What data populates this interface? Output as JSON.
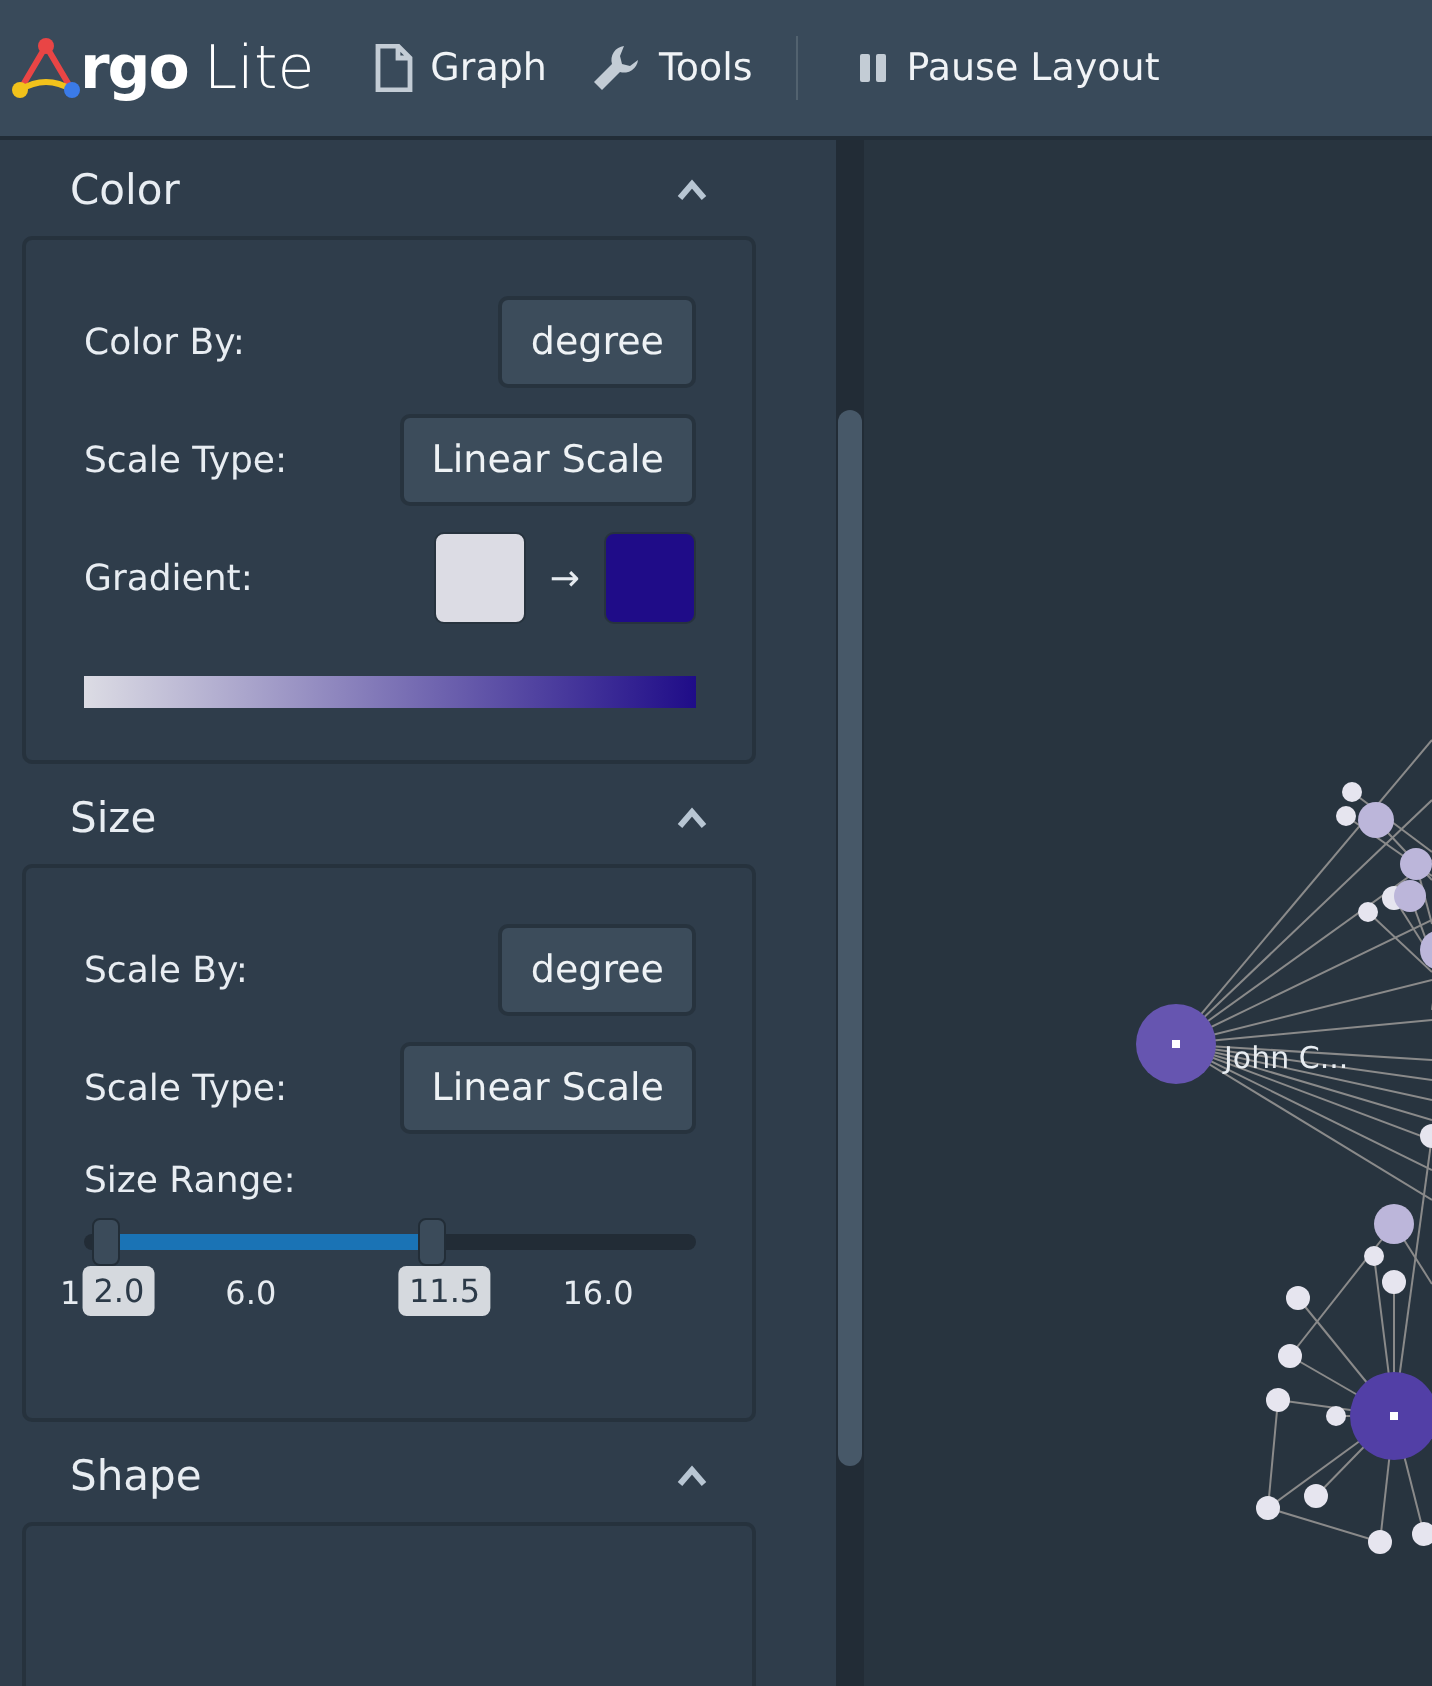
{
  "app": {
    "logo_word": "rgo",
    "logo_suffix": "Lite"
  },
  "toolbar": [
    {
      "kind": "file",
      "label": "Graph"
    },
    {
      "kind": "wrench",
      "label": "Tools"
    },
    {
      "kind": "pause",
      "label": "Pause Layout"
    }
  ],
  "sections": [
    {
      "title": "Color",
      "expanded": true,
      "kind": "color",
      "rows": [
        {
          "label": "Color By:",
          "value": "degree"
        },
        {
          "label": "Scale Type:",
          "value": "Linear Scale"
        }
      ],
      "gradient": {
        "label": "Gradient:",
        "arrow": "→",
        "swatches": [
          {
            "color": "#dcdce4"
          },
          {
            "color": "#1f0c88"
          }
        ]
      }
    },
    {
      "title": "Size",
      "expanded": true,
      "kind": "size",
      "rows": [
        {
          "label": "Scale By:",
          "value": "degree"
        },
        {
          "label": "Scale Type:",
          "value": "Linear Scale"
        }
      ],
      "range": {
        "label": "Size Range:",
        "low": {
          "level": 0.036,
          "label": "2.0"
        },
        "high": {
          "level": 0.567,
          "label": "11.5"
        },
        "ticks": [
          "1",
          "6.0",
          "16.0"
        ]
      }
    },
    {
      "title": "Shape",
      "expanded": true,
      "kind": "shape"
    }
  ],
  "graph": {
    "node_label": "John C..."
  }
}
